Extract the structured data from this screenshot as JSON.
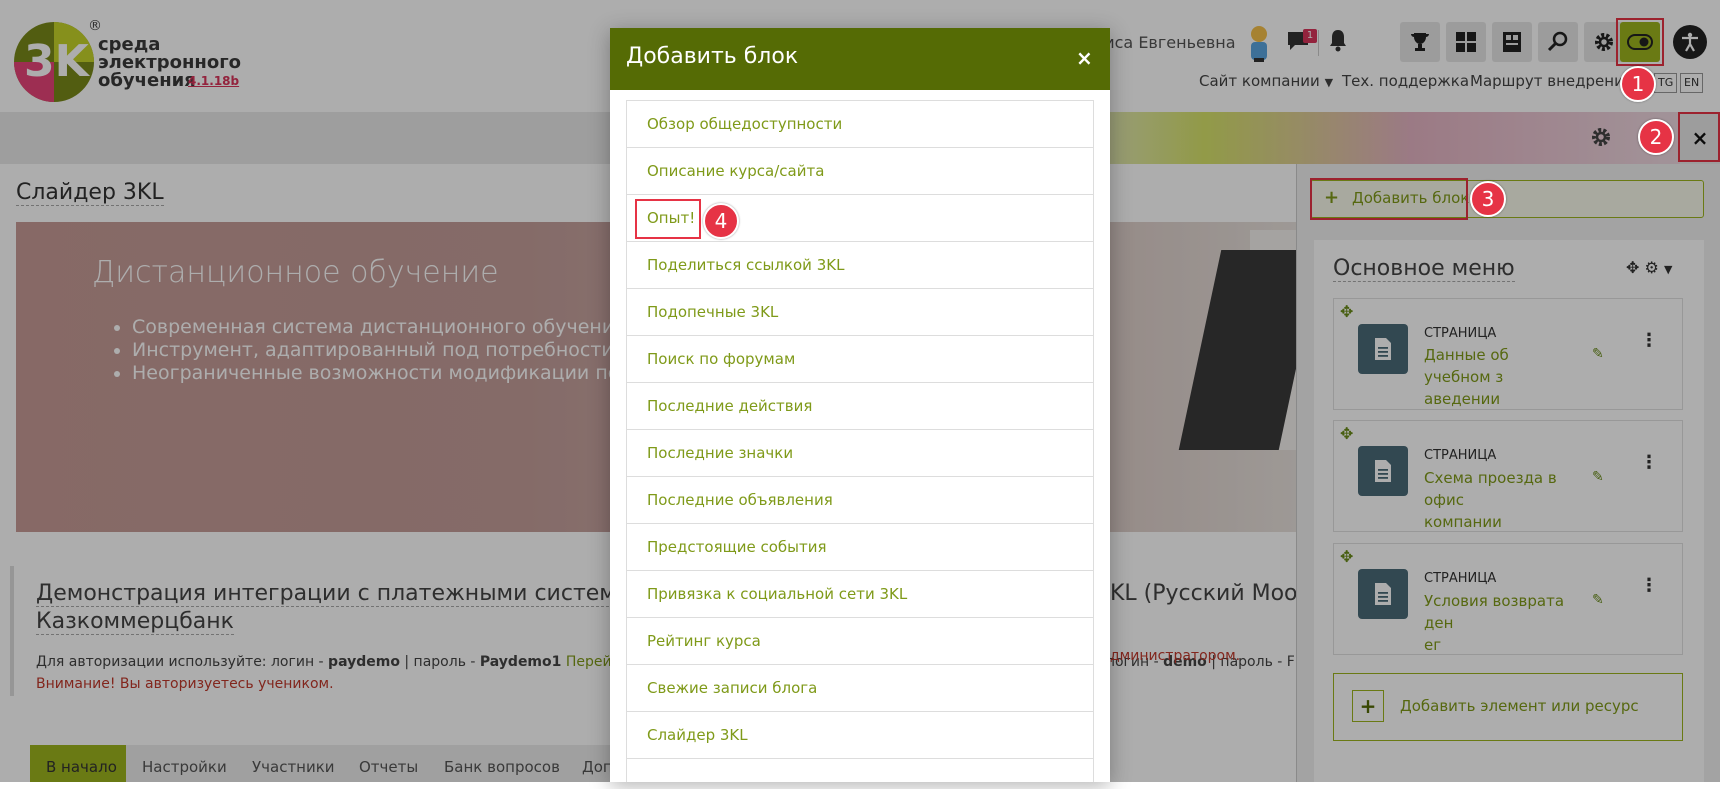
{
  "header": {
    "logo_mark": "3K",
    "logo_reg": "®",
    "logo_lines": [
      "среда",
      "электронного",
      "обучения"
    ],
    "version": "4.1.18b",
    "user_name": "лиса Евгеньевна",
    "messages_badge": "1",
    "nav": {
      "company_site": "Сайт компании",
      "support": "Тех. поддержка",
      "route": "Маршрут внедрения",
      "lang_tg": "TG",
      "lang_en": "EN"
    }
  },
  "annotations": [
    "1",
    "2",
    "3",
    "4"
  ],
  "main": {
    "page_title": "Слайдер 3KL",
    "slider": {
      "title": "Дистанционное обучение",
      "bullets": [
        "Современная система дистанционного обучения и к",
        "Инструмент, адаптированный под потребности росс",
        "Неограниченные возможности модификации под за"
      ]
    },
    "section": {
      "title_line1_left": "Демонстрация интеграции с платежными системами Н",
      "title_line1_right": "KL (Русский Mood",
      "title_line2": "Казкоммерцбанк",
      "auth_prefix": "Для авторизации используйте: логин - ",
      "auth_login": "paydemo",
      "auth_mid": " | пароль - ",
      "auth_pass": "Paydemo1",
      "auth_link": " Перейти",
      "auth_right_prefix": "логин - ",
      "auth_right_login": "demo",
      "auth_right_mid": " | пароль - F",
      "admin_text": "дминистратором.",
      "warning": "Внимание! Вы авторизуетесь учеником."
    },
    "tabs": [
      "В начало",
      "Настройки",
      "Участники",
      "Отчеты",
      "Банк вопросов",
      "Доп"
    ]
  },
  "modal": {
    "title": "Добавить блок",
    "close": "×",
    "items": [
      "Обзор общедоступности",
      "Описание курса/сайта",
      "Опыт!",
      "Поделиться ссылкой 3KL",
      "Подопечные 3KL",
      "Поиск по форумам",
      "Последние действия",
      "Последние значки",
      "Последние объявления",
      "Предстоящие события",
      "Привязка к социальной сети 3KL",
      "Рейтинг курса",
      "Свежие записи блога",
      "Слайдер 3KL"
    ]
  },
  "drawer": {
    "add_block": "Добавить блок",
    "menu_title": "Основное меню",
    "activities": [
      {
        "type": "СТРАНИЦА",
        "name_lines": [
          "Данные об учебном з",
          "аведении"
        ]
      },
      {
        "type": "СТРАНИЦА",
        "name_lines": [
          "Схема проезда в офис",
          "компании"
        ]
      },
      {
        "type": "СТРАНИЦА",
        "name_lines": [
          "Условия возврата ден",
          "ег"
        ]
      }
    ],
    "add_resource": "Добавить элемент или ресурс"
  },
  "banner": {
    "close": "×"
  },
  "colors": {
    "accent": "#9cb41e",
    "modal_header": "#556b05",
    "link": "#7f9a19",
    "highlight": "#e63345"
  }
}
